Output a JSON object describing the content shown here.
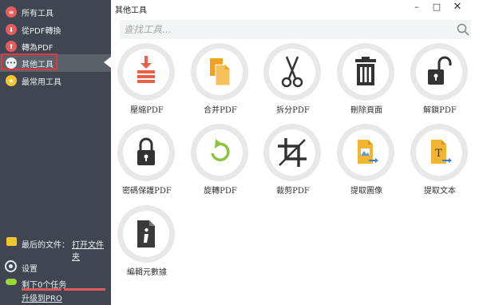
{
  "sidebar": {
    "items": [
      {
        "label": "所有工具",
        "color": "#e45c5c",
        "glyph": "≡"
      },
      {
        "label": "從PDF轉換",
        "color": "#e45c5c",
        "glyph": "⬇"
      },
      {
        "label": "轉為PDF",
        "color": "#e45c5c",
        "glyph": "⬆"
      },
      {
        "label": "其他工具",
        "color": "#eceef1",
        "glyph": "•••"
      },
      {
        "label": "最常用工具",
        "color": "#f2c531",
        "glyph": "★"
      }
    ],
    "recent_label": "最后的文件：",
    "open_folder": "打开文件夹",
    "settings_label": "设置",
    "tasks_label": "剩下0个任务",
    "upgrade_label": "升级到PRO"
  },
  "window": {
    "title": "其他工具"
  },
  "search": {
    "placeholder": "查找工具..."
  },
  "tools": [
    {
      "label": "壓縮PDF",
      "icon": "compress-icon"
    },
    {
      "label": "合并PDF",
      "icon": "merge-icon"
    },
    {
      "label": "拆分PDF",
      "icon": "scissors-icon"
    },
    {
      "label": "刪除頁面",
      "icon": "trash-icon"
    },
    {
      "label": "解鎖PDF",
      "icon": "unlock-icon"
    },
    {
      "label": "密碼保護PDF",
      "icon": "lock-icon"
    },
    {
      "label": "旋轉PDF",
      "icon": "rotate-icon"
    },
    {
      "label": "裁剪PDF",
      "icon": "crop-icon"
    },
    {
      "label": "提取圖像",
      "icon": "extract-image-icon"
    },
    {
      "label": "提取文本",
      "icon": "extract-text-icon"
    },
    {
      "label": "編輯元數據",
      "icon": "metadata-icon"
    }
  ],
  "colors": {
    "sidebar_bg": "#3f4651",
    "accent_red": "#e2373d",
    "orange": "#f2a21e",
    "green": "#8cc63f"
  }
}
